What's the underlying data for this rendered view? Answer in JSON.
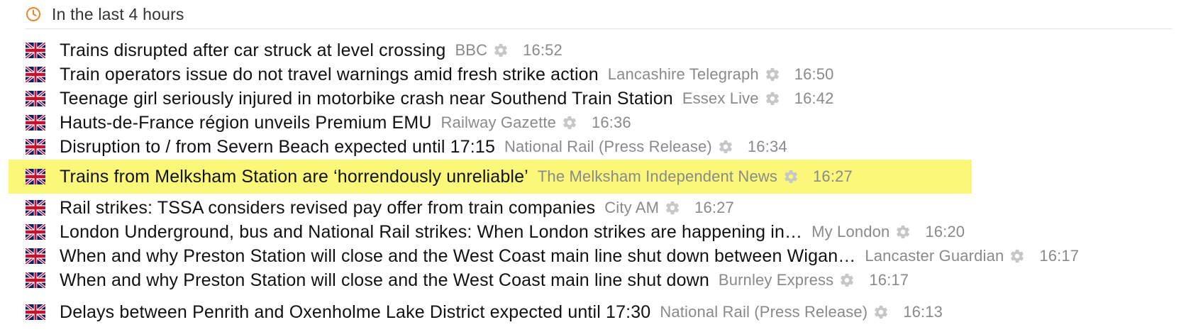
{
  "section": {
    "header": "In the last 4 hours",
    "icon": "clock-icon"
  },
  "colors": {
    "accent": "#e8872b",
    "highlight": "#fbf779",
    "source_text": "#8a8a8a"
  },
  "items": [
    {
      "title": "Trains disrupted after car struck at level crossing",
      "source": "BBC",
      "time": "16:52",
      "icon": "uk-flag-icon"
    },
    {
      "title": "Train operators issue do not travel warnings amid fresh strike action",
      "source": "Lancashire Telegraph",
      "time": "16:50",
      "icon": "uk-flag-icon"
    },
    {
      "title": "Teenage girl seriously injured in motorbike crash near Southend Train Station",
      "source": "Essex Live",
      "time": "16:42",
      "icon": "uk-flag-icon"
    },
    {
      "title": "Hauts-de-France région unveils Premium EMU",
      "source": "Railway Gazette",
      "time": "16:36",
      "icon": "uk-flag-icon"
    },
    {
      "title": "Disruption to / from Severn Beach expected until 17:15",
      "source": "National Rail (Press Release)",
      "time": "16:34",
      "icon": "uk-flag-icon"
    },
    {
      "title": "Trains from Melksham Station are ‘horrendously unreliable’",
      "source": "The Melksham Independent News",
      "time": "16:27",
      "icon": "uk-flag-icon",
      "highlighted": true
    },
    {
      "title": "Rail strikes: TSSA considers revised pay offer from train companies",
      "source": "City AM",
      "time": "16:27",
      "icon": "uk-flag-icon"
    },
    {
      "title": "London Underground, bus and National Rail strikes: When London strikes are happening in…",
      "source": "My London",
      "time": "16:20",
      "icon": "uk-flag-icon"
    },
    {
      "title": "When and why Preston Station will close and the West Coast main line shut down between Wigan…",
      "source": "Lancaster Guardian",
      "time": "16:17",
      "icon": "uk-flag-icon"
    },
    {
      "title": "When and why Preston Station will close and the West Coast main line shut down",
      "source": "Burnley Express",
      "time": "16:17",
      "icon": "uk-flag-icon"
    },
    {
      "title": "Delays between Penrith and Oxenholme Lake District expected until 17:30",
      "source": "National Rail (Press Release)",
      "time": "16:13",
      "icon": "uk-flag-icon"
    }
  ]
}
